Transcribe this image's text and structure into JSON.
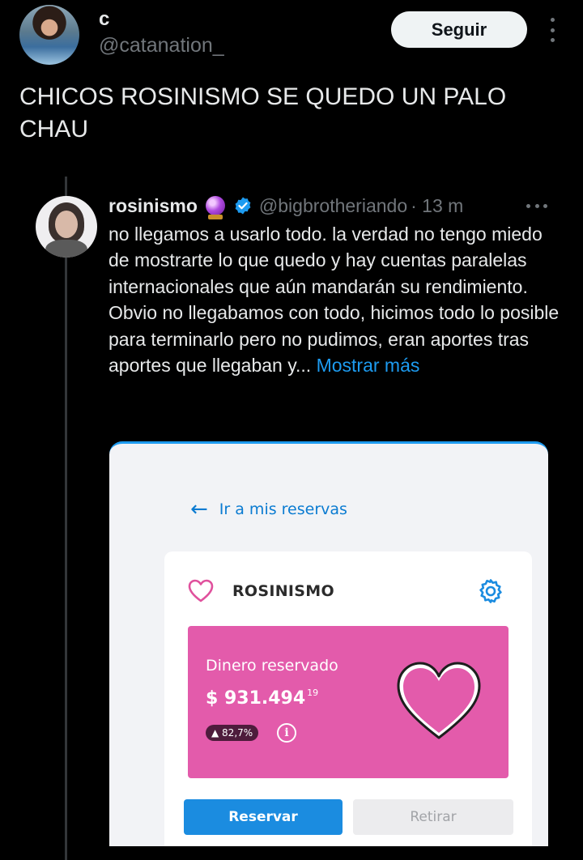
{
  "author": {
    "display_name": "c",
    "handle": "@catanation_",
    "follow_label": "Seguir"
  },
  "tweet": {
    "text": "CHICOS ROSINISMO SE QUEDO UN PALO CHAU"
  },
  "quoted_tweet": {
    "display_name": "rosinismo",
    "handle": "@bigbrotheriando",
    "time": "· 13 m",
    "text": "no llegamos a usarlo todo. la verdad no tengo miedo de mostrarte lo que quedo y hay cuentas paralelas internacionales que aún mandarán su rendimiento. Obvio no llegabamos con todo, hicimos todo lo posible para terminarlo pero no pudimos, eran aportes tras aportes que llegaban y...",
    "show_more": "Mostrar más"
  },
  "media": {
    "back_link": "Ir a mis reservas",
    "card_title": "ROSINISMO",
    "reserved_label": "Dinero reservado",
    "amount": "$ 931.494",
    "amount_cents": "19",
    "change_pct": "▲ 82,7%",
    "info_symbol": "i",
    "reserve_button": "Reservar",
    "withdraw_button": "Retirar",
    "colors": {
      "pink_panel": "#e35bab",
      "primary_button": "#1b8ce0",
      "link": "#1d9bf0"
    }
  }
}
